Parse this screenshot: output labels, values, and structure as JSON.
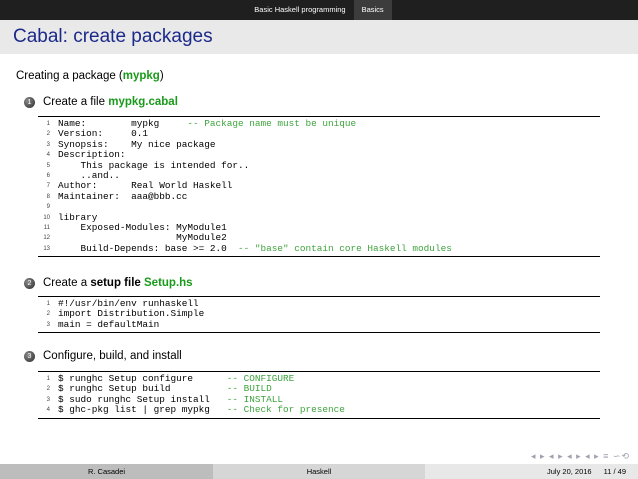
{
  "nav": {
    "section": "Basic Haskell programming",
    "subsection": "Basics"
  },
  "title": "Cabal: create packages",
  "intro": {
    "text": "Creating a package (",
    "pkg": "mypkg",
    "close": ")"
  },
  "steps": [
    {
      "num": "1",
      "pre": "Create a file ",
      "bold": "",
      "green": "mypkg.cabal"
    },
    {
      "num": "2",
      "pre": "Create a ",
      "bold": "setup file",
      "green": "Setup.hs"
    },
    {
      "num": "3",
      "pre": "Configure, build, and install",
      "bold": "",
      "green": ""
    }
  ],
  "code1": [
    {
      "n": "1",
      "t": "Name:        mypkg     ",
      "c": "-- Package name must be unique"
    },
    {
      "n": "2",
      "t": "Version:     0.1",
      "c": ""
    },
    {
      "n": "3",
      "t": "Synopsis:    My nice package",
      "c": ""
    },
    {
      "n": "4",
      "t": "Description:",
      "c": ""
    },
    {
      "n": "5",
      "t": "    This package is intended for..",
      "c": ""
    },
    {
      "n": "6",
      "t": "    ..and..",
      "c": ""
    },
    {
      "n": "7",
      "t": "Author:      Real World Haskell",
      "c": ""
    },
    {
      "n": "8",
      "t": "Maintainer:  aaa@bbb.cc",
      "c": ""
    },
    {
      "n": "9",
      "t": "",
      "c": ""
    },
    {
      "n": "10",
      "t": "library",
      "c": ""
    },
    {
      "n": "11",
      "t": "    Exposed-Modules: MyModule1",
      "c": ""
    },
    {
      "n": "12",
      "t": "                     MyModule2",
      "c": ""
    },
    {
      "n": "13",
      "t": "    Build-Depends: base >= 2.0  ",
      "c": "-- \"base\" contain core Haskell modules"
    }
  ],
  "code2": [
    {
      "n": "1",
      "t": "#!/usr/bin/env runhaskell",
      "c": ""
    },
    {
      "n": "2",
      "t": "import Distribution.Simple",
      "c": ""
    },
    {
      "n": "3",
      "t": "main = defaultMain",
      "c": ""
    }
  ],
  "code3": [
    {
      "n": "1",
      "t": "$ runghc Setup configure      ",
      "c": "-- CONFIGURE"
    },
    {
      "n": "2",
      "t": "$ runghc Setup build          ",
      "c": "-- BUILD"
    },
    {
      "n": "3",
      "t": "$ sudo runghc Setup install   ",
      "c": "-- INSTALL"
    },
    {
      "n": "4",
      "t": "$ ghc-pkg list | grep mypkg   ",
      "c": "-- Check for presence"
    }
  ],
  "footer": {
    "author": "R. Casadei",
    "topic": "Haskell",
    "date": "July 20, 2016",
    "page": "11 / 49"
  }
}
